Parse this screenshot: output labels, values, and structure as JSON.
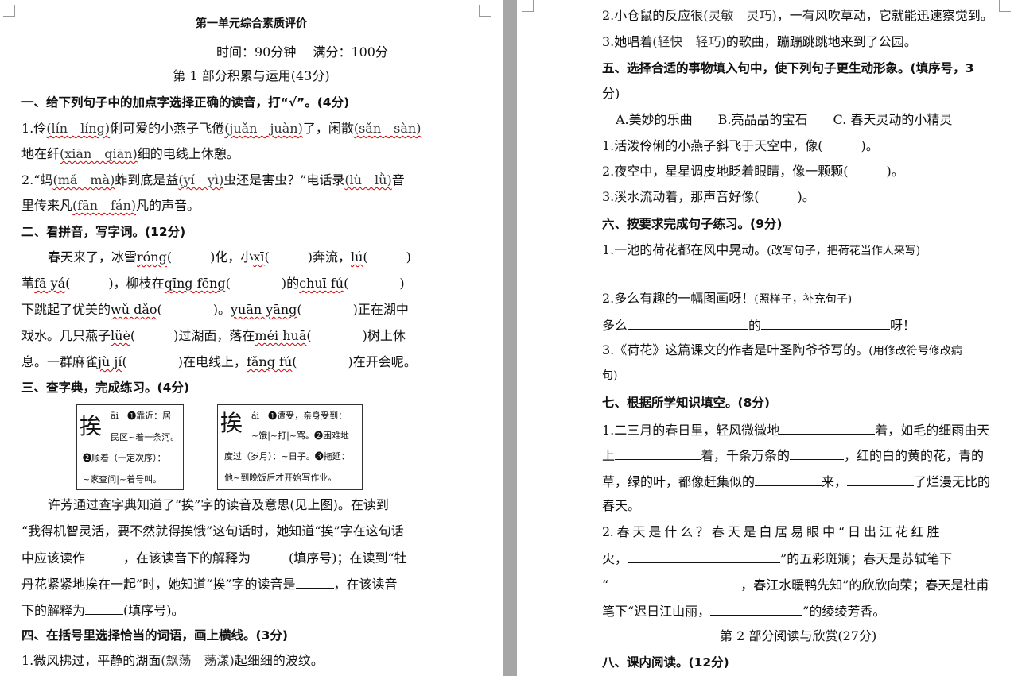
{
  "left": {
    "title": "第一单元综合素质评价",
    "meta": "时间：90分钟　 满分：100分",
    "part1": "第 1 部分积累与运用(43分)",
    "s1": {
      "title": "一、给下列句子中的加点字选择正确的读音，打“√”。(4分)",
      "l1": [
        "1.伶",
        "(lín　líng)",
        "俐可爱的小燕子飞倦",
        "(juǎn　juàn)",
        "了，闲散",
        "(sǎn　sàn)"
      ],
      "l2": [
        "地在纤",
        "(xiān　qiān)",
        "细的电线上休憩。"
      ],
      "l3": [
        "2.“蚂",
        "(mǎ　mà)",
        "蚱到底是益",
        "(yí　yì)",
        "虫还是害虫？”电话录",
        "(lù　lǜ)",
        "音"
      ],
      "l4": [
        "里传来凡",
        "(fān　fán)",
        "凡的声音。"
      ]
    },
    "s2": {
      "title": "二、看拼音，写字词。(12分)",
      "l1": [
        "春天来了，冰雪",
        "róng",
        "(　　　)化，小",
        "xī",
        "(　　　)奔流，",
        "lú",
        "(　　　)"
      ],
      "l2": [
        "苇",
        "fā yá",
        "(　　　)，柳枝在",
        "qīng fēng",
        "(　　　　)的",
        "chuī fú",
        "(　　　　)"
      ],
      "l3": [
        "下跳起了优美的",
        "wǔ dǎo",
        "(　　　　)。",
        "yuān yāng",
        "(　　　　)正在湖中"
      ],
      "l4": [
        "戏水。几只燕子",
        "lüè",
        "(　　　)过湖面，落在",
        "méi huā",
        "(　　　　)树上休"
      ],
      "l5": [
        "息。一群麻雀",
        "jù jí",
        "(　　　　)在电线上，",
        "fǎng fú",
        "(　　　　)在开会呢。"
      ]
    },
    "s3": {
      "title": "三、查字典，完成练习。(4分)",
      "dict1": {
        "char": "挨",
        "l1": "āi　❶靠近：居",
        "l2": "民区~着一条河。",
        "l3": "❷顺着（一定次序）：",
        "l4": "~家查问|~着号叫。"
      },
      "dict2": {
        "char": "挨",
        "l1": "ái　❶遭受，亲身受到：",
        "l2": "~饿|~打|~骂。❷困难地",
        "l3": "度过（岁月）：~日子。❸拖延：",
        "l4": "他~到晚饭后才开始写作业。"
      },
      "p1": "许芳通过查字典知道了“挨”字的读音及意思(见上图)。在读到",
      "p2": "“我得机智灵活，要不然就得挨饿”这句话时，她知道“挨”字在这句话",
      "p3a": "中应该读作",
      "p3b": "，在该读音下的解释为",
      "p3c": "(填序号)；在读到“牡",
      "p4a": "丹花紧紧地挨在一起”时，她知道“挨”字的读音是",
      "p4b": "，在该读音",
      "p5a": "下的解释为",
      "p5b": "(填序号)。"
    },
    "s4": {
      "title": "四、在括号里选择恰当的词语，画上横线。(3分)",
      "l1a": "1.微风拂过，平静的湖面",
      "l1b": "(飘荡　荡漾)",
      "l1c": "起细细的波纹。"
    }
  },
  "right": {
    "l1a": "2.小仓鼠的反应很",
    "l1b": "(灵敏　灵巧)",
    "l1c": "，一有风吹草动，它就能迅速察觉到。",
    "l2a": "3.她唱着",
    "l2b": "(轻快　轻巧)",
    "l2c": "的歌曲，蹦蹦跳跳地来到了公园。",
    "s5": {
      "title": "五、选择合适的事物填入句中，使下列句子更生动形象。(填序号，3",
      "title2": "分)",
      "opts": "A.美妙的乐曲　　B.亮晶晶的宝石　　C. 春天灵动的小精灵",
      "q1": "1.活泼伶俐的小燕子斜飞于天空中，像(　　　)。",
      "q2": "2.夜空中，星星调皮地眨着眼睛，像一颗颗(　　　)。",
      "q3": "3.溪水流动着，那声音好像(　　　)。"
    },
    "s6": {
      "title": "六、按要求完成句子练习。(9分)",
      "q1a": "1.一池的荷花都在风中晃动。",
      "q1b": "(改写句子，把荷花当作人来写)",
      "q2a": "2.多么有趣的一幅图画呀！",
      "q2b": "(照样子，补充句子)",
      "q2c1": "多么",
      "q2c2": "的",
      "q2c3": "呀！",
      "q3a": "3.《荷花》这篇课文的作者是叶圣陶爷爷写的。",
      "q3b": "(用修改符号修改病",
      "q3c": "句)"
    },
    "s7": {
      "title": "七、根据所学知识填空。(8分)",
      "a1": "1.二三月的春日里，轻风微微地",
      "a2": "着，如毛的细雨由天",
      "b1": "上",
      "b2": "着，千条万条的",
      "b3": "，红的白的黄的花，青的",
      "c1": "草，绿的叶，都像赶集似的",
      "c2": "来，",
      "c3": "了烂漫无比的",
      "d1": "春天。",
      "e1": "2. 春 天 是 什 么 ？ 春 天 是 白 居 易 眼 中 “ 日 出 江 花 红 胜",
      "f1": "火，",
      "f2": "”的五彩斑斓；春天是苏轼笔下",
      "g1": "“",
      "g2": "，春江水暖鸭先知”的欣欣向荣；春天是杜甫",
      "h1": "笔下“迟日江山丽，",
      "h2": "”的绫绫芳香。"
    },
    "part2": "第 2 部分阅读与欣赏(27分)",
    "s8": {
      "title": "八、课内阅读。(12分)"
    }
  }
}
